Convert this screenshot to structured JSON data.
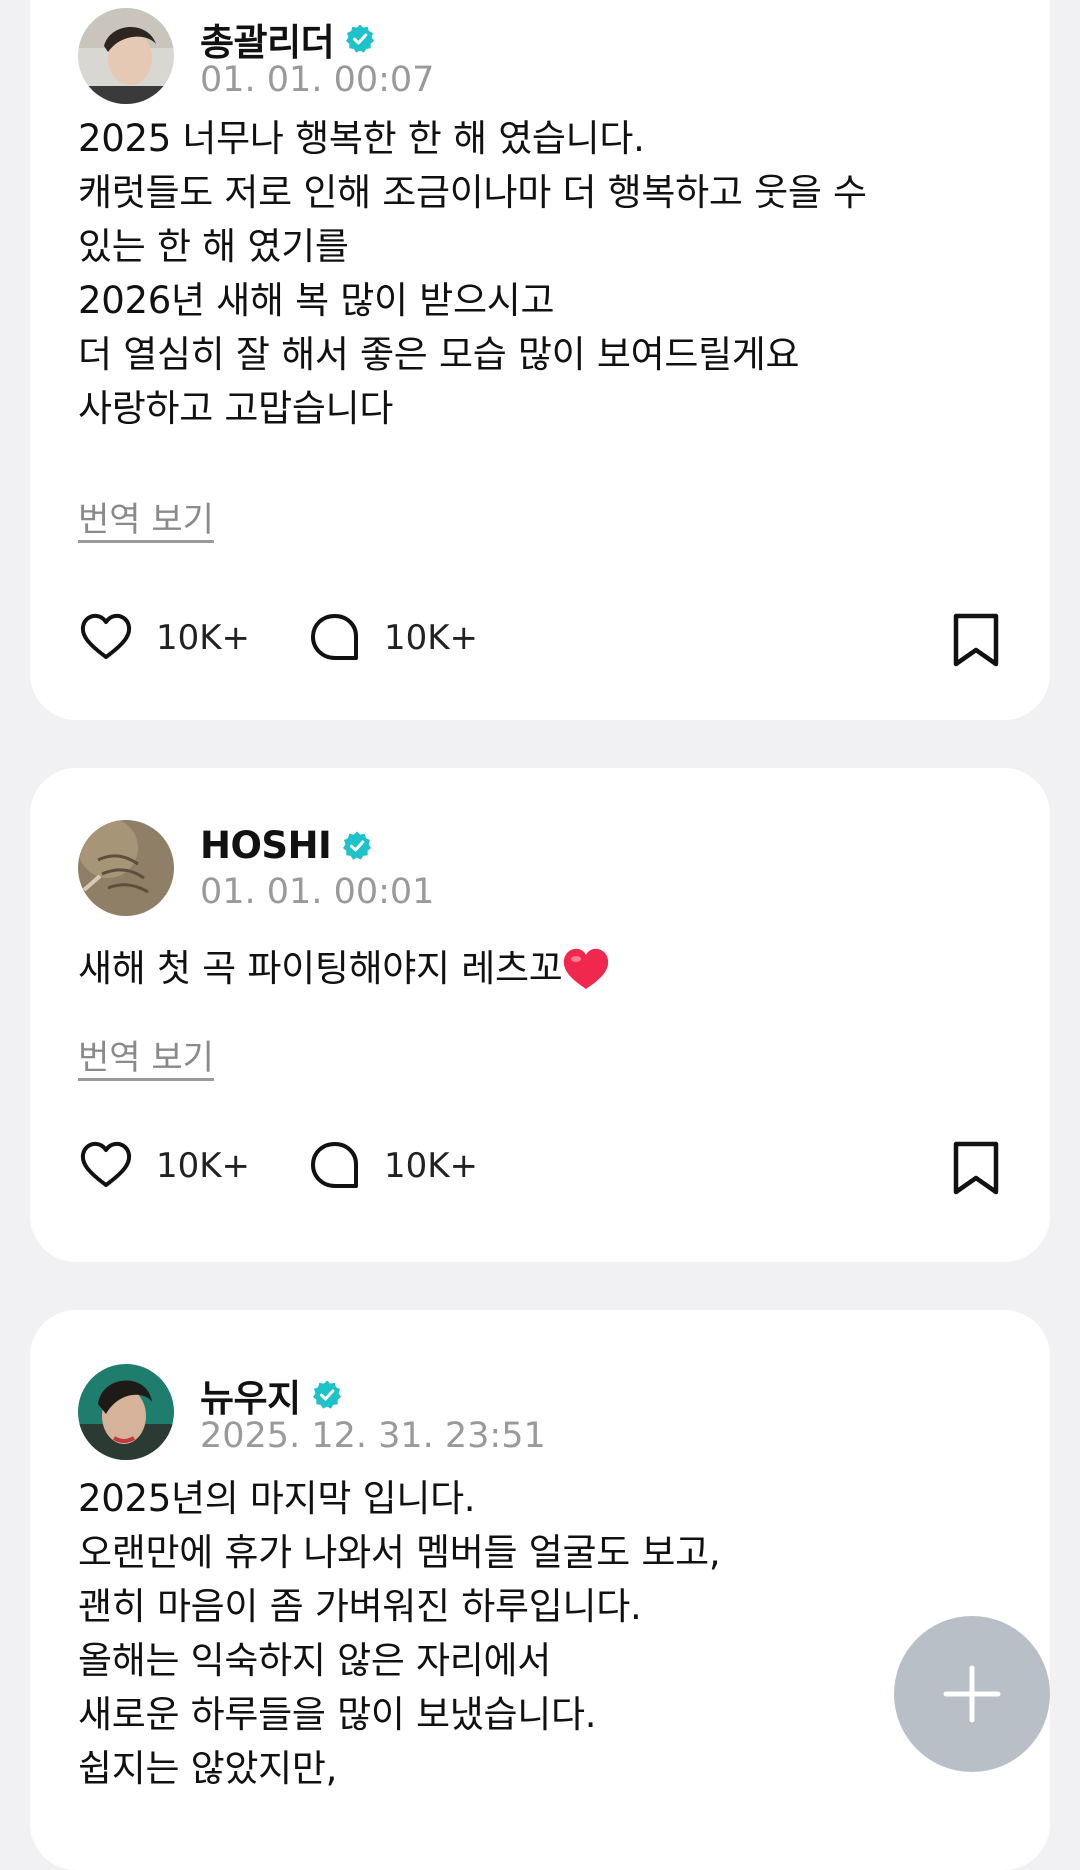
{
  "posts": [
    {
      "author": "총괄리더",
      "time": "01. 01. 00:07",
      "lines": [
        "2025 너무나 행복한 한 해 였습니다.",
        "캐럿들도 저로 인해 조금이나마 더 행복하고 웃을 수",
        "있는 한 해 였기를",
        "2026년 새해 복 많이 받으시고",
        "더 열심히 잘 해서 좋은 모습 많이 보여드릴게요",
        "사랑하고 고맙습니다"
      ],
      "translate": "번역 보기",
      "likes": "10K+",
      "comments": "10K+"
    },
    {
      "author": "HOSHI",
      "time": "01. 01. 00:01",
      "lines": [
        "새해 첫 곡 파이팅해야지 레츠꼬"
      ],
      "translate": "번역 보기",
      "likes": "10K+",
      "comments": "10K+"
    },
    {
      "author": "뉴우지",
      "time": "2025. 12. 31. 23:51",
      "lines": [
        "2025년의 마지막 입니다.",
        "오랜만에 휴가 나와서 멤버들 얼굴도 보고,",
        "괜히 마음이 좀 가벼워진 하루입니다.",
        "올해는 익숙하지 않은 자리에서",
        "새로운 하루들을 많이 보냈습니다.",
        "쉽지는 않았지만,"
      ]
    }
  ],
  "icons": {
    "verified": "verified-badge-icon",
    "like": "heart-icon",
    "comment": "speech-bubble-icon",
    "bookmark": "bookmark-icon",
    "fab": "plus-icon",
    "emoji": "red-heart-emoji"
  },
  "colors": {
    "verified": "#1ec2c9",
    "fab": "#b8bfc6",
    "background": "#f1f1f3",
    "time": "#9a9a9a"
  }
}
